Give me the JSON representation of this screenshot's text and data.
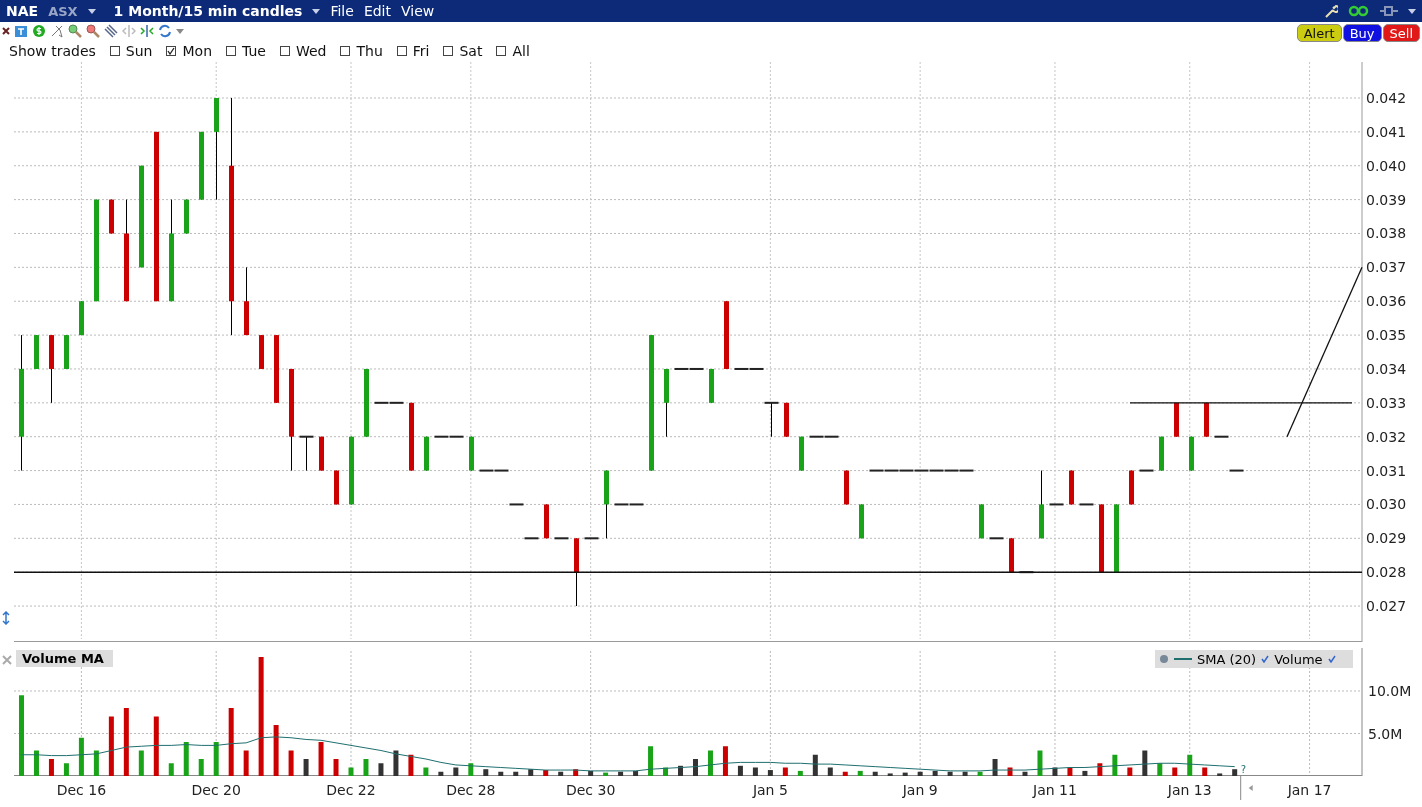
{
  "title_bar": {
    "symbol": "NAE",
    "exchange": "ASX",
    "period": "1 Month/15 min candles",
    "menus": [
      "File",
      "Edit",
      "View"
    ]
  },
  "order_buttons": [
    {
      "label": "Alert",
      "kind": "alert"
    },
    {
      "label": "Buy",
      "kind": "buy"
    },
    {
      "label": "Sell",
      "kind": "sell"
    }
  ],
  "show_trades": {
    "label": "Show trades",
    "days": [
      {
        "label": "Sun",
        "checked": false
      },
      {
        "label": "Mon",
        "checked": true
      },
      {
        "label": "Tue",
        "checked": false
      },
      {
        "label": "Wed",
        "checked": false
      },
      {
        "label": "Thu",
        "checked": false
      },
      {
        "label": "Fri",
        "checked": false
      },
      {
        "label": "Sat",
        "checked": false
      },
      {
        "label": "All",
        "checked": false
      }
    ]
  },
  "price_chart": {
    "axis_labels": [
      "0.042",
      "0.041",
      "0.040",
      "0.039",
      "0.038",
      "0.037",
      "0.036",
      "0.035",
      "0.034",
      "0.033",
      "0.032",
      "0.031",
      "0.030",
      "0.029",
      "0.028",
      "0.027"
    ]
  },
  "volume_chart": {
    "title": "Volume MA",
    "marker_label": "?",
    "chart_data": {
      "type": "bar",
      "grid": true,
      "ylim": [
        0,
        15.06
      ],
      "categories": [
        null,
        null,
        null,
        null,
        "Dec 16",
        null,
        null,
        null,
        null,
        null,
        null,
        null,
        null,
        "Dec 20",
        null,
        null,
        null,
        null,
        null,
        null,
        null,
        null,
        "Dec 22",
        null,
        null,
        null,
        null,
        null,
        null,
        null,
        "Dec 28",
        null,
        null,
        null,
        null,
        null,
        null,
        null,
        "Dec 30",
        null,
        null,
        null,
        null,
        null,
        null,
        null,
        null,
        null,
        null,
        null,
        "Jan 5",
        null,
        null,
        null,
        null,
        null,
        null,
        null,
        null,
        null,
        "Jan 9",
        null,
        null,
        null,
        null,
        null,
        null,
        null,
        null,
        "Jan 11",
        null,
        null,
        null,
        null,
        null,
        null,
        null,
        null,
        "Jan 13",
        null,
        null,
        null,
        null,
        null,
        null,
        null,
        "Jan 17",
        null,
        null,
        null
      ],
      "yticks": [
        {
          "value": 10,
          "label": "10.0M"
        },
        {
          "value": 5,
          "label": "5.0M"
        }
      ],
      "series": [
        {
          "name": "SMA (20)",
          "type": "line",
          "color": "#1f6f6f",
          "values": [
            2.5,
            2.5,
            2.4,
            2.4,
            2.5,
            2.6,
            3,
            3.4,
            3.5,
            3.6,
            3.6,
            3.7,
            3.6,
            3.6,
            3.8,
            3.9,
            4.5,
            4.6,
            4.5,
            4.3,
            4.2,
            3.9,
            3.6,
            3.3,
            3,
            2.6,
            2.3,
            2,
            1.6,
            1.3,
            1.2,
            1.1,
            1,
            0.9,
            0.8,
            0.7,
            0.7,
            0.7,
            0.6,
            0.6,
            0.6,
            0.6,
            0.8,
            0.9,
            1,
            1.1,
            1.3,
            1.5,
            1.6,
            1.6,
            1.6,
            1.5,
            1.5,
            1.4,
            1.4,
            1.3,
            1.2,
            1.1,
            1,
            0.9,
            0.8,
            0.7,
            0.6,
            0.6,
            0.6,
            0.7,
            0.7,
            0.7,
            0.8,
            0.9,
            1,
            1,
            1.1,
            1.2,
            1.3,
            1.4,
            1.5,
            1.5,
            1.4,
            1.3,
            1.2,
            1.1,
            null,
            null,
            null,
            null,
            null,
            null,
            null,
            null
          ]
        },
        {
          "name": "Volume",
          "type": "bar",
          "colors": [
            "#19a319",
            "#19a319",
            "#cc0000",
            "#19a319",
            "#19a319",
            "#19a319",
            "#cc0000",
            "#cc0000",
            "#19a319",
            "#cc0000",
            "#19a319",
            "#19a319",
            "#19a319",
            "#19a319",
            "#cc0000",
            "#cc0000",
            "#cc0000",
            "#cc0000",
            "#cc0000",
            "#333333",
            "#cc0000",
            "#cc0000",
            "#19a319",
            "#19a319",
            "#333333",
            "#333333",
            "#cc0000",
            "#19a319",
            "#333333",
            "#333333",
            "#19a319",
            "#333333",
            "#333333",
            "#333333",
            "#333333",
            "#cc0000",
            "#333333",
            "#cc0000",
            "#333333",
            "#19a319",
            "#333333",
            "#333333",
            "#19a319",
            "#19a319",
            "#333333",
            "#333333",
            "#19a319",
            "#cc0000",
            "#333333",
            "#333333",
            "#333333",
            "#cc0000",
            "#19a319",
            "#333333",
            "#333333",
            "#cc0000",
            "#19a319",
            "#333333",
            "#333333",
            "#333333",
            "#333333",
            "#333333",
            "#333333",
            "#333333",
            "#19a319",
            "#333333",
            "#cc0000",
            "#333333",
            "#19a319",
            "#333333",
            "#cc0000",
            "#333333",
            "#cc0000",
            "#19a319",
            "#cc0000",
            "#333333",
            "#19a319",
            "#cc0000",
            "#19a319",
            "#cc0000",
            "#333333",
            "#333333",
            null,
            null,
            null,
            null,
            null,
            null,
            null,
            null
          ],
          "values": [
            9.5,
            3,
            2,
            1.5,
            4.5,
            3,
            7,
            8,
            3,
            7,
            1.5,
            4,
            2,
            4,
            8,
            3,
            14,
            6,
            3,
            2,
            4,
            2,
            1,
            2,
            1.5,
            3,
            2.5,
            1,
            0.5,
            1,
            1.5,
            0.8,
            0.5,
            0.5,
            0.8,
            0.7,
            0.5,
            0.8,
            0.6,
            0.4,
            0.5,
            0.6,
            3.5,
            1,
            1.2,
            2,
            3,
            3.5,
            1.2,
            1,
            0.7,
            1,
            0.6,
            2.5,
            1,
            0.5,
            0.6,
            0.5,
            0.3,
            0.4,
            0.5,
            0.6,
            0.5,
            0.5,
            0.5,
            2,
            1,
            0.5,
            3,
            1,
            1,
            0.6,
            1.5,
            2.5,
            1,
            3,
            1.5,
            1,
            2.5,
            1,
            0.3,
            0.8,
            null,
            null,
            null,
            null,
            null,
            null,
            null,
            null
          ]
        }
      ]
    }
  }
}
